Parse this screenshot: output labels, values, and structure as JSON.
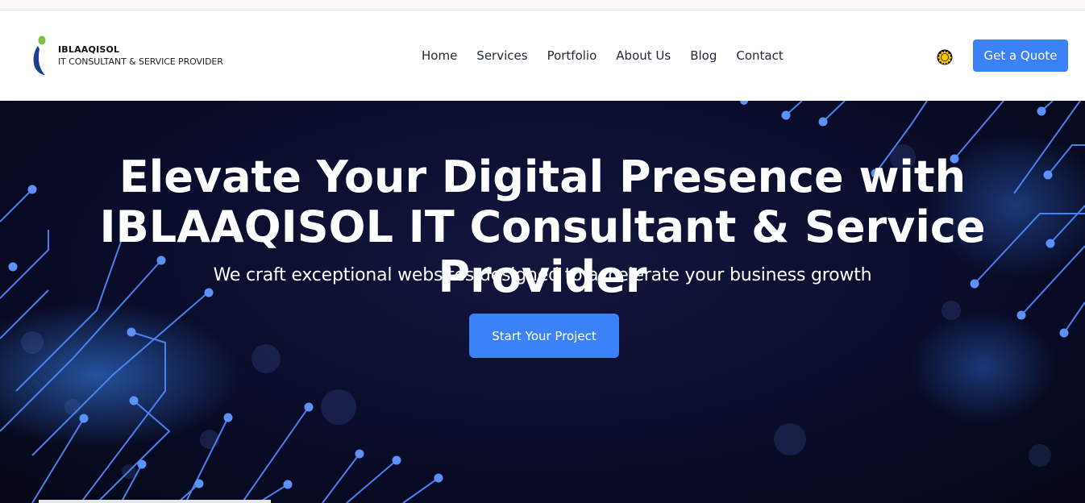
{
  "brand": {
    "name": "IBLAAQISOL",
    "tagline": "IT CONSULTANT & SERVICE PROVIDER",
    "logo_icon": "person-i-logo-icon"
  },
  "nav": {
    "items": [
      {
        "label": "Home"
      },
      {
        "label": "Services"
      },
      {
        "label": "Portfolio"
      },
      {
        "label": "About Us"
      },
      {
        "label": "Blog"
      },
      {
        "label": "Contact"
      }
    ]
  },
  "header": {
    "theme_toggle_icon": "sun-icon",
    "quote_button": "Get a Quote"
  },
  "hero": {
    "title_line1": "Elevate Your Digital Presence with",
    "title_line2": "IBLAAQISOL IT Consultant & Service Provider",
    "subtitle": "We craft exceptional websites designed to accelerate your business growth",
    "cta": "Start Your Project"
  },
  "colors": {
    "accent": "#3b82f6",
    "hero_bg": "#0a0c2a",
    "circuit": "#4f86f7"
  }
}
